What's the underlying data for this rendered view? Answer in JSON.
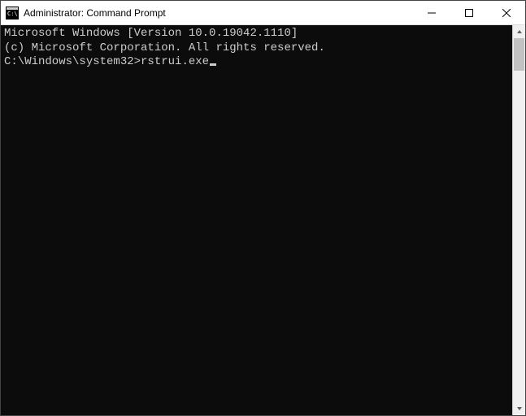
{
  "window": {
    "title": "Administrator: Command Prompt"
  },
  "terminal": {
    "line1": "Microsoft Windows [Version 10.0.19042.1110]",
    "line2": "(c) Microsoft Corporation. All rights reserved.",
    "blank": "",
    "prompt": "C:\\Windows\\system32>",
    "command": "rstrui.exe"
  }
}
